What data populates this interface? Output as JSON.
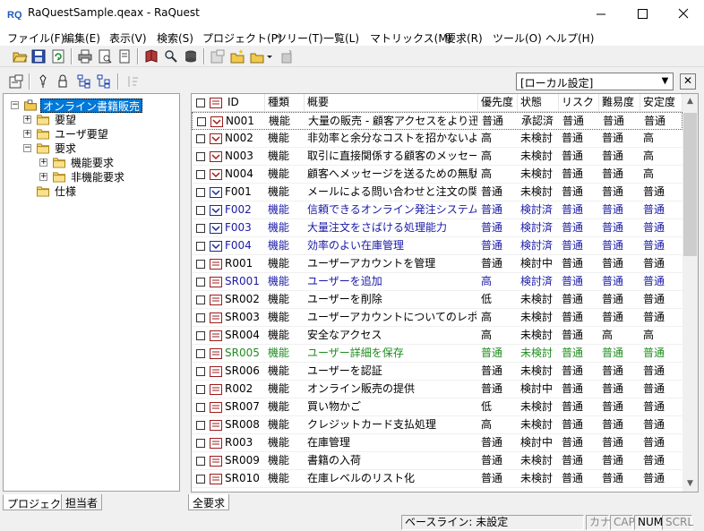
{
  "window": {
    "title": "RaQuestSample.qeax - RaQuest",
    "minimize": "─",
    "maximize": "☐",
    "close": "✕"
  },
  "menu": [
    "ファイル(F)",
    "編集(E)",
    "表示(V)",
    "検索(S)",
    "プロジェクト(P)",
    "ツリー(T)",
    "一覧(L)",
    "マトリックス(M)",
    "要求(R)",
    "ツール(O)",
    "ヘルプ(H)"
  ],
  "toolbar": {
    "icons": [
      "open-icon",
      "save-icon",
      "refresh-icon",
      "print-icon",
      "print-preview-icon",
      "page-setup-icon",
      "book-icon",
      "search-icon",
      "database-icon",
      "properties-icon",
      "new-folder-icon",
      "new-item-icon",
      "dropdown-arrow-icon",
      "settings-icon"
    ]
  },
  "tree": {
    "toolbar_icons": [
      "properties-icon",
      "pin-icon",
      "lock-icon",
      "tree-expand-icon",
      "tree-collapse-icon",
      "sort-icon"
    ],
    "root": "オンライン書籍販売",
    "nodes": [
      "要望",
      "ユーザ要望",
      "要求",
      "機能要求",
      "非機能要求",
      "仕様"
    ]
  },
  "left_tabs": [
    "プロジェクト",
    "担当者"
  ],
  "view_select": {
    "value": "[ローカル設定]",
    "arrow": "▼",
    "close": "✕"
  },
  "grid": {
    "columns": [
      "ID",
      "種類",
      "概要",
      "優先度",
      "状態",
      "リスク",
      "難易度",
      "安定度"
    ],
    "rows": [
      {
        "id": "N001",
        "type": "機能",
        "summary": "大量の販売 - 顧客アクセスをより迅...",
        "priority": "普通",
        "status": "承認済",
        "risk": "普通",
        "difficulty": "普通",
        "stability": "普通",
        "color": "#000000",
        "icon": "need"
      },
      {
        "id": "N002",
        "type": "機能",
        "summary": "非効率と余分なコストを招かないよう...",
        "priority": "高",
        "status": "未検討",
        "risk": "普通",
        "difficulty": "普通",
        "stability": "高",
        "color": "#000000",
        "icon": "need"
      },
      {
        "id": "N003",
        "type": "機能",
        "summary": "取引に直接関係する顧客のメッセー...",
        "priority": "高",
        "status": "未検討",
        "risk": "普通",
        "difficulty": "普通",
        "stability": "高",
        "color": "#000000",
        "icon": "need"
      },
      {
        "id": "N004",
        "type": "機能",
        "summary": "顧客へメッセージを送るための無駄...",
        "priority": "高",
        "status": "未検討",
        "risk": "普通",
        "difficulty": "普通",
        "stability": "高",
        "color": "#000000",
        "icon": "need"
      },
      {
        "id": "F001",
        "type": "機能",
        "summary": "メールによる問い合わせと注文の関...",
        "priority": "普通",
        "status": "未検討",
        "risk": "普通",
        "difficulty": "普通",
        "stability": "普通",
        "color": "#000000",
        "icon": "feature"
      },
      {
        "id": "F002",
        "type": "機能",
        "summary": "信頼できるオンライン発注システム...",
        "priority": "普通",
        "status": "検討済",
        "risk": "普通",
        "difficulty": "普通",
        "stability": "普通",
        "color": "#1a1aa6",
        "icon": "feature"
      },
      {
        "id": "F003",
        "type": "機能",
        "summary": "大量注文をさばける処理能力",
        "priority": "普通",
        "status": "検討済",
        "risk": "普通",
        "difficulty": "普通",
        "stability": "普通",
        "color": "#1a1aa6",
        "icon": "feature"
      },
      {
        "id": "F004",
        "type": "機能",
        "summary": "効率のよい在庫管理",
        "priority": "普通",
        "status": "検討済",
        "risk": "普通",
        "difficulty": "普通",
        "stability": "普通",
        "color": "#1a1aa6",
        "icon": "feature"
      },
      {
        "id": "R001",
        "type": "機能",
        "summary": "ユーザーアカウントを管理",
        "priority": "普通",
        "status": "検討中",
        "risk": "普通",
        "difficulty": "普通",
        "stability": "普通",
        "color": "#000000",
        "icon": "req"
      },
      {
        "id": "SR001",
        "type": "機能",
        "summary": "ユーザーを追加",
        "priority": "高",
        "status": "検討済",
        "risk": "普通",
        "difficulty": "普通",
        "stability": "普通",
        "color": "#1a1aa6",
        "icon": "req"
      },
      {
        "id": "SR002",
        "type": "機能",
        "summary": "ユーザーを削除",
        "priority": "低",
        "status": "未検討",
        "risk": "普通",
        "difficulty": "普通",
        "stability": "普通",
        "color": "#000000",
        "icon": "req"
      },
      {
        "id": "SR003",
        "type": "機能",
        "summary": "ユーザーアカウントについてのレポ...",
        "priority": "高",
        "status": "未検討",
        "risk": "普通",
        "difficulty": "普通",
        "stability": "普通",
        "color": "#000000",
        "icon": "req"
      },
      {
        "id": "SR004",
        "type": "機能",
        "summary": "安全なアクセス",
        "priority": "高",
        "status": "未検討",
        "risk": "普通",
        "difficulty": "高",
        "stability": "高",
        "color": "#000000",
        "icon": "req"
      },
      {
        "id": "SR005",
        "type": "機能",
        "summary": "ユーザー詳細を保存",
        "priority": "普通",
        "status": "未検討",
        "risk": "普通",
        "difficulty": "普通",
        "stability": "普通",
        "color": "#1f8c1f",
        "icon": "req"
      },
      {
        "id": "SR006",
        "type": "機能",
        "summary": "ユーザーを認証",
        "priority": "普通",
        "status": "未検討",
        "risk": "普通",
        "difficulty": "普通",
        "stability": "普通",
        "color": "#000000",
        "icon": "req"
      },
      {
        "id": "R002",
        "type": "機能",
        "summary": "オンライン販売の提供",
        "priority": "普通",
        "status": "検討中",
        "risk": "普通",
        "difficulty": "普通",
        "stability": "普通",
        "color": "#000000",
        "icon": "req"
      },
      {
        "id": "SR007",
        "type": "機能",
        "summary": "買い物かご",
        "priority": "低",
        "status": "未検討",
        "risk": "普通",
        "difficulty": "普通",
        "stability": "普通",
        "color": "#000000",
        "icon": "req"
      },
      {
        "id": "SR008",
        "type": "機能",
        "summary": "クレジットカード支払処理",
        "priority": "高",
        "status": "未検討",
        "risk": "普通",
        "difficulty": "普通",
        "stability": "普通",
        "color": "#000000",
        "icon": "req"
      },
      {
        "id": "R003",
        "type": "機能",
        "summary": "在庫管理",
        "priority": "普通",
        "status": "検討中",
        "risk": "普通",
        "difficulty": "普通",
        "stability": "普通",
        "color": "#000000",
        "icon": "req"
      },
      {
        "id": "SR009",
        "type": "機能",
        "summary": "書籍の入荷",
        "priority": "普通",
        "status": "未検討",
        "risk": "普通",
        "difficulty": "普通",
        "stability": "普通",
        "color": "#000000",
        "icon": "req"
      },
      {
        "id": "SR010",
        "type": "機能",
        "summary": "在庫レベルのリスト化",
        "priority": "普通",
        "status": "未検討",
        "risk": "普通",
        "difficulty": "普通",
        "stability": "普通",
        "color": "#000000",
        "icon": "req"
      }
    ]
  },
  "right_tab": "全要求",
  "status": {
    "baseline": "ベースライン: 未設定",
    "kana": "カナ",
    "cap": "CAP",
    "num": "NUM",
    "scrl": "SCRL"
  },
  "scrollbar": {
    "up": "▲",
    "down": "▼"
  }
}
